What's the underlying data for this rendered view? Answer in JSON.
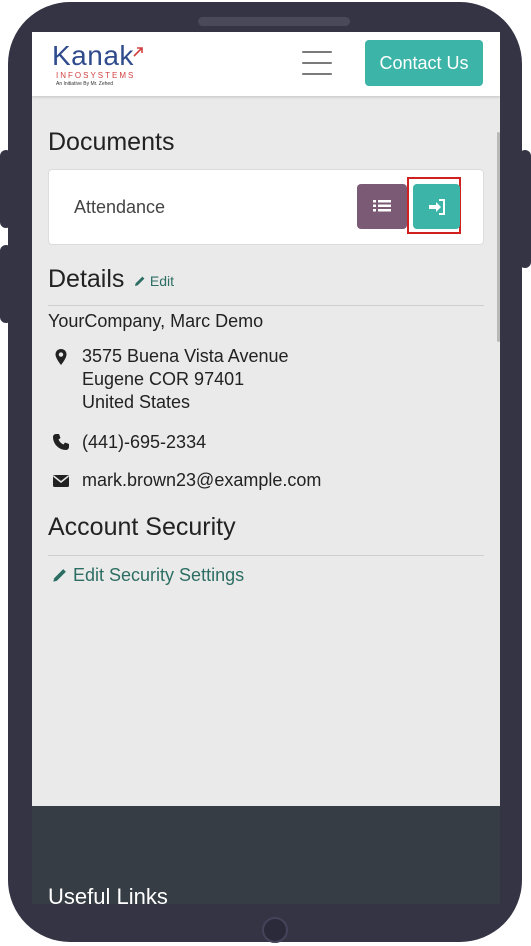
{
  "brand": {
    "logo_main": "Kanak",
    "logo_sub": "INFOSYSTEMS",
    "logo_tagline": "An Initiative By Mr. Zehed"
  },
  "navbar": {
    "contact_label": "Contact Us"
  },
  "documents": {
    "title": "Documents",
    "item_label": "Attendance"
  },
  "details": {
    "title": "Details",
    "edit_label": "Edit",
    "company": "YourCompany, Marc Demo",
    "address_line1": "3575 Buena Vista Avenue",
    "address_line2": "Eugene COR 97401",
    "address_line3": "United States",
    "phone": "(441)-695-2334",
    "email": "mark.brown23@example.com"
  },
  "security": {
    "title": "Account Security",
    "link_label": "Edit Security Settings"
  },
  "footer": {
    "title": "Useful Links"
  },
  "colors": {
    "accent": "#3cb4a8",
    "list_button": "#7a5a75",
    "link": "#2c6e63",
    "footer_bg": "#373d44",
    "phone_frame": "#353445",
    "highlight": "#d0201f"
  },
  "icons": [
    "hamburger-menu-icon",
    "list-icon",
    "sign-in-icon",
    "pencil-icon",
    "map-marker-icon",
    "phone-icon",
    "envelope-icon"
  ]
}
